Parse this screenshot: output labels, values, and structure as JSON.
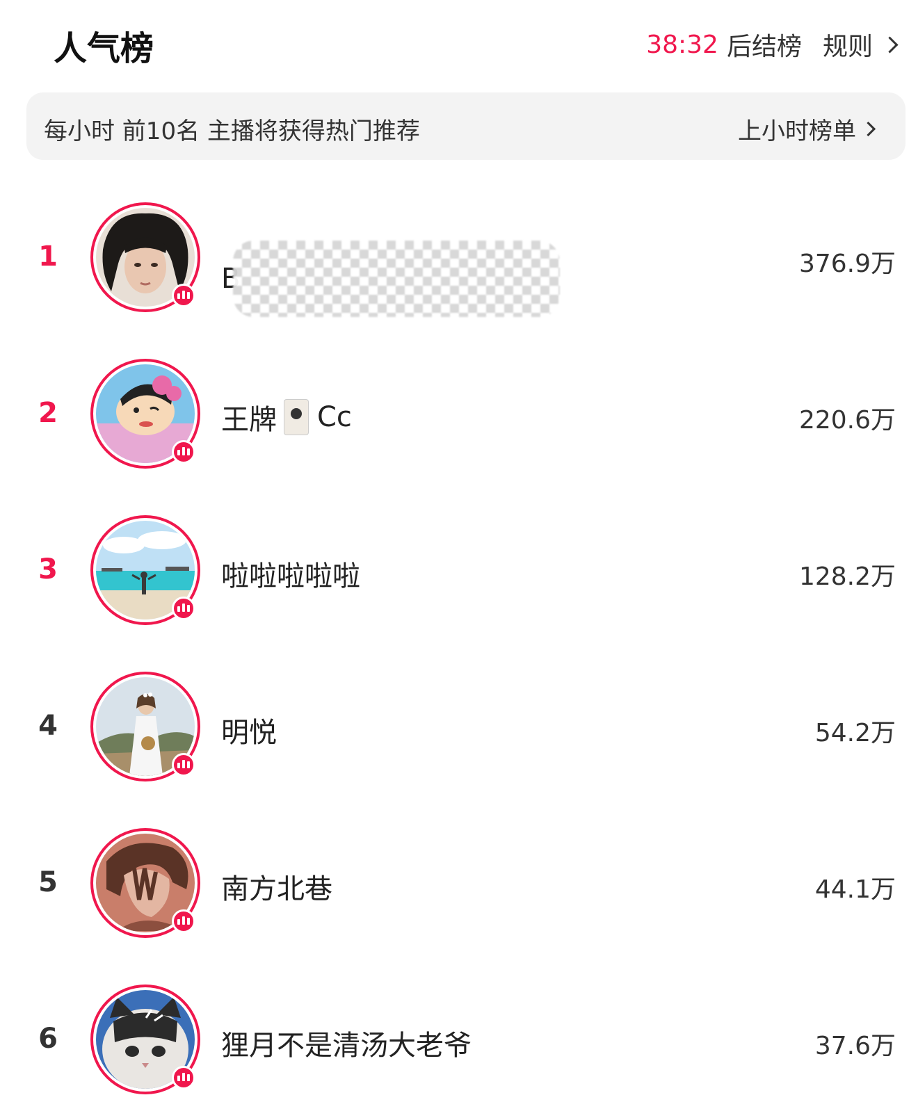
{
  "header": {
    "title": "人气榜",
    "countdown": "38:32",
    "countdown_suffix": "后结榜",
    "rules_label": "规则"
  },
  "notice": {
    "text": "每小时 前10名 主播将获得热门推荐",
    "link_label": "上小时榜单"
  },
  "ranking": [
    {
      "rank": "1",
      "name": "B",
      "score": "376.9万"
    },
    {
      "rank": "2",
      "name": "王牌",
      "name_suffix": "Cc",
      "score": "220.6万"
    },
    {
      "rank": "3",
      "name": "啦啦啦啦啦",
      "score": "128.2万"
    },
    {
      "rank": "4",
      "name": "明悦",
      "score": "54.2万"
    },
    {
      "rank": "5",
      "name": "南方北巷",
      "score": "44.1万"
    },
    {
      "rank": "6",
      "name": "狸月不是清汤大老爷",
      "score": "37.6万"
    }
  ],
  "colors": {
    "accent": "#f0174d",
    "notice_bg": "#f3f3f3"
  }
}
